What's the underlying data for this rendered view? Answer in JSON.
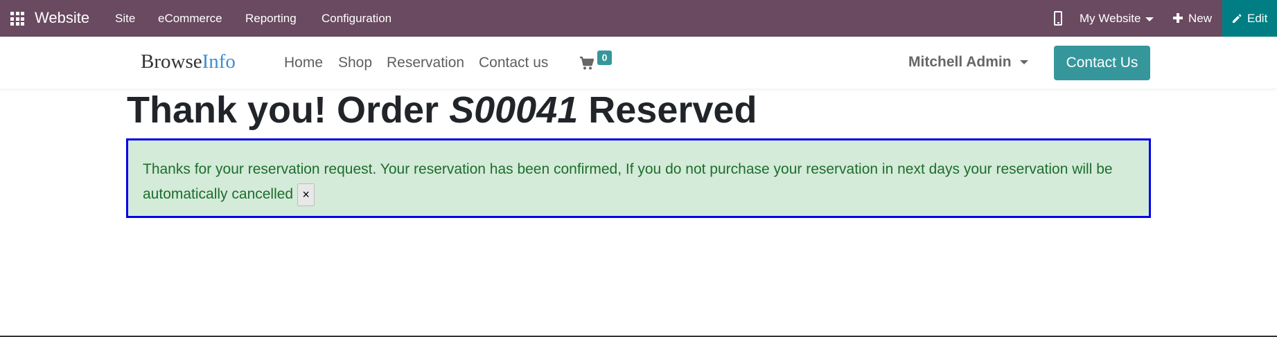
{
  "topbar": {
    "brand": "Website",
    "menu": [
      "Site",
      "eCommerce",
      "Reporting",
      "Configuration"
    ],
    "website_selector": "My Website",
    "new_label": "New",
    "edit_label": "Edit",
    "colors": {
      "bar": "#694a60",
      "edit": "#017e84"
    }
  },
  "header": {
    "logo_part1": "Browse",
    "logo_part2": "Info",
    "nav": [
      "Home",
      "Shop",
      "Reservation",
      "Contact us"
    ],
    "cart_count": "0",
    "user_name": "Mitchell Admin",
    "contact_button": "Contact Us",
    "colors": {
      "accent": "#35979c",
      "logo_info": "#3a8fd6"
    }
  },
  "main": {
    "title_prefix": "Thank you! Order ",
    "order_number": "S00041",
    "title_suffix": " Reserved",
    "alert_message": "Thanks for your reservation request. Your reservation has been confirmed, If you do not purchase your reservation in next days your reservation will be automatically cancelled",
    "close_label": "×",
    "colors": {
      "alert_bg": "#d4ebd9",
      "alert_border": "#0000e6",
      "alert_text": "#1d6d2c"
    }
  },
  "icons": [
    "apps-grid-icon",
    "mobile-preview-icon",
    "caret-down-icon",
    "plus-icon",
    "pencil-icon",
    "shopping-cart-icon"
  ]
}
